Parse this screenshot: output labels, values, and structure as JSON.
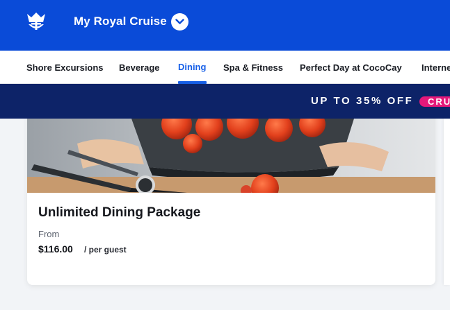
{
  "header": {
    "ship_name": "My Royal Cruise",
    "logo_icon": "crown-anchor-icon",
    "toggle_icon": "chevron-down-icon",
    "brand_color": "#0a4bd8"
  },
  "tabs": [
    {
      "label": "Shore Excursions",
      "active": false
    },
    {
      "label": "Beverage",
      "active": false
    },
    {
      "label": "Dining",
      "active": true
    },
    {
      "label": "Spa & Fitness",
      "active": false
    },
    {
      "label": "Perfect Day at CocoCay",
      "active": false
    },
    {
      "label": "Interne",
      "active": false
    }
  ],
  "promo": {
    "text": "UP TO 35% OFF",
    "pill": "CRU",
    "background": "#0d2368",
    "pill_color": "#e5187a"
  },
  "card": {
    "title": "Unlimited Dining Package",
    "from_label": "From",
    "price": "$116.00",
    "price_suffix": "/ per guest",
    "image_subject": "chef-cooking-tomatoes-image"
  }
}
